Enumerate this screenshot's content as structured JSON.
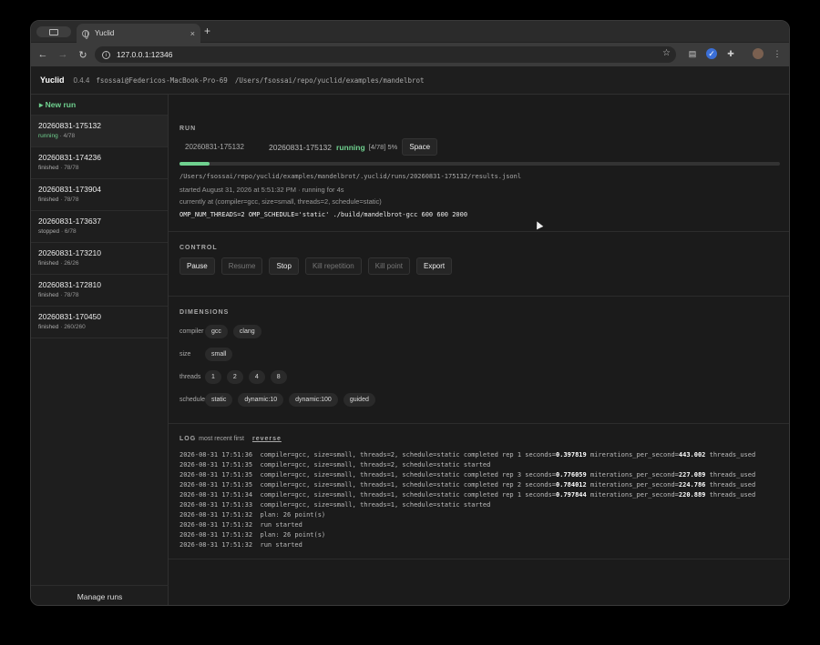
{
  "browser": {
    "tab_title": "Yuclid",
    "url": "127.0.0.1:12346",
    "tab_close": "×",
    "new_tab": "+"
  },
  "app": {
    "brand": "Yuclid",
    "version": "0.4.4",
    "host": "fsossai@Federicos-MacBook-Pro-69",
    "path": "/Users/fsossai/repo/yuclid/examples/mandelbrot"
  },
  "sidebar": {
    "new_run": "New run",
    "runs": [
      {
        "id": "20260831-175132",
        "status": "running",
        "progress": "4/78"
      },
      {
        "id": "20260831-174236",
        "status": "finished",
        "progress": "78/78"
      },
      {
        "id": "20260831-173904",
        "status": "finished",
        "progress": "78/78"
      },
      {
        "id": "20260831-173637",
        "status": "stopped",
        "progress": "6/78"
      },
      {
        "id": "20260831-173210",
        "status": "finished",
        "progress": "26/26"
      },
      {
        "id": "20260831-172810",
        "status": "finished",
        "progress": "78/78"
      },
      {
        "id": "20260831-170450",
        "status": "finished",
        "progress": "260/260"
      }
    ],
    "manage_runs": "Manage runs"
  },
  "run": {
    "section_title": "RUN",
    "selected": "20260831-175132",
    "id": "20260831-175132",
    "status": "running",
    "progress_text": "[4/78] 5%",
    "progress_fraction": 0.05,
    "space_button": "Space",
    "results_path": "/Users/fsossai/repo/yuclid/examples/mandelbrot/.yuclid/runs/20260831-175132/results.jsonl",
    "started": "started August 31, 2026 at 5:51:32 PM · running for 4s",
    "currently": "currently at (compiler=gcc, size=small, threads=2, schedule=static)",
    "command": "OMP_NUM_THREADS=2 OMP_SCHEDULE='static' ./build/mandelbrot-gcc 600 600 2000"
  },
  "control": {
    "section_title": "CONTROL",
    "buttons": {
      "pause": "Pause",
      "resume": "Resume",
      "stop": "Stop",
      "kill_repetition": "Kill repetition",
      "kill_point": "Kill point",
      "export": "Export"
    }
  },
  "dimensions": {
    "section_title": "DIMENSIONS",
    "rows": [
      {
        "label": "compiler",
        "values": [
          "gcc",
          "clang"
        ]
      },
      {
        "label": "size",
        "values": [
          "small"
        ]
      },
      {
        "label": "threads",
        "values": [
          "1",
          "2",
          "4",
          "8"
        ]
      },
      {
        "label": "schedule",
        "values": [
          "static",
          "dynamic:10",
          "dynamic:100",
          "guided"
        ]
      }
    ]
  },
  "log": {
    "section_title": "LOG",
    "order": "most recent first",
    "reverse": "reverse",
    "lines": [
      {
        "pre": "2026-08-31 17:51:36  compiler=gcc, size=small, threads=2, schedule=static completed rep 1 seconds=",
        "v1": "0.397819",
        "mid": " mirerations_per_second=",
        "v2": "443.002",
        "post": " threads_used"
      },
      {
        "pre": "2026-08-31 17:51:35  compiler=gcc, size=small, threads=2, schedule=static started",
        "v1": "",
        "mid": "",
        "v2": "",
        "post": ""
      },
      {
        "pre": "2026-08-31 17:51:35  compiler=gcc, size=small, threads=1, schedule=static completed rep 3 seconds=",
        "v1": "0.776059",
        "mid": " miterations_per_second=",
        "v2": "227.089",
        "post": " threads_used"
      },
      {
        "pre": "2026-08-31 17:51:35  compiler=gcc, size=small, threads=1, schedule=static completed rep 2 seconds=",
        "v1": "0.784012",
        "mid": " miterations_per_second=",
        "v2": "224.786",
        "post": " threads_used"
      },
      {
        "pre": "2026-08-31 17:51:34  compiler=gcc, size=small, threads=1, schedule=static completed rep 1 seconds=",
        "v1": "0.797844",
        "mid": " miterations_per_second=",
        "v2": "220.889",
        "post": " threads_used"
      },
      {
        "pre": "2026-08-31 17:51:33  compiler=gcc, size=small, threads=1, schedule=static started",
        "v1": "",
        "mid": "",
        "v2": "",
        "post": ""
      },
      {
        "pre": "2026-08-31 17:51:32  plan: 26 point(s)",
        "v1": "",
        "mid": "",
        "v2": "",
        "post": ""
      },
      {
        "pre": "2026-08-31 17:51:32  run started",
        "v1": "",
        "mid": "",
        "v2": "",
        "post": ""
      },
      {
        "pre": "2026-08-31 17:51:32  plan: 26 point(s)",
        "v1": "",
        "mid": "",
        "v2": "",
        "post": ""
      },
      {
        "pre": "2026-08-31 17:51:32  run started",
        "v1": "",
        "mid": "",
        "v2": "",
        "post": ""
      }
    ]
  },
  "colors": {
    "accent": "#6fd18f",
    "background": "#1b1b1b"
  }
}
